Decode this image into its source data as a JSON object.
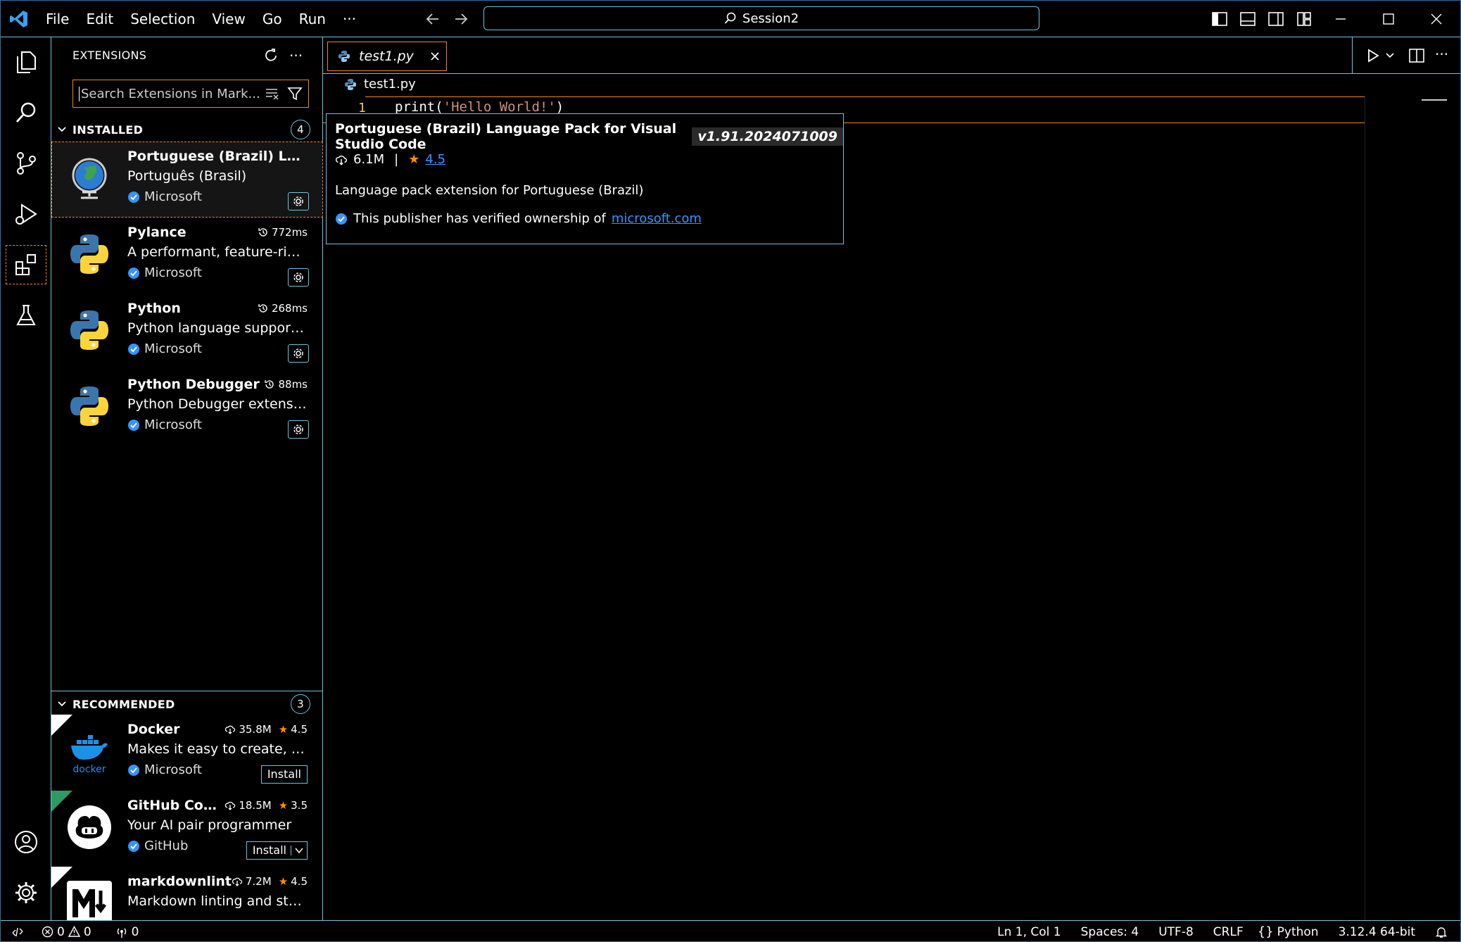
{
  "titlebar": {
    "menu": [
      "File",
      "Edit",
      "Selection",
      "View",
      "Go",
      "Run",
      "···"
    ],
    "command_center": "Session2"
  },
  "sidebar": {
    "title": "EXTENSIONS",
    "search_placeholder": "Search Extensions in Mark...",
    "installed": {
      "label": "INSTALLED",
      "count": "4",
      "items": [
        {
          "name": "Portuguese (Brazil) Langu...",
          "desc": "Português (Brasil)",
          "publisher": "Microsoft",
          "time": ""
        },
        {
          "name": "Pylance",
          "desc": "A performant, feature-rich la...",
          "publisher": "Microsoft",
          "time": "772ms"
        },
        {
          "name": "Python",
          "desc": "Python language support wi...",
          "publisher": "Microsoft",
          "time": "268ms"
        },
        {
          "name": "Python Debugger",
          "desc": "Python Debugger extension...",
          "publisher": "Microsoft",
          "time": "88ms"
        }
      ]
    },
    "recommended": {
      "label": "RECOMMENDED",
      "count": "3",
      "items": [
        {
          "name": "Docker",
          "desc": "Makes it easy to create, man...",
          "publisher": "Microsoft",
          "downloads": "35.8M",
          "rating": "4.5",
          "button": "Install",
          "icon_text": "docker"
        },
        {
          "name": "GitHub Copi...",
          "desc": "Your AI pair programmer",
          "publisher": "GitHub",
          "downloads": "18.5M",
          "rating": "3.5",
          "button": "Install"
        },
        {
          "name": "markdownlint",
          "desc": "Markdown linting and style ...",
          "publisher": "",
          "downloads": "7.2M",
          "rating": "4.5",
          "button": ""
        }
      ]
    }
  },
  "editor": {
    "tab": "test1.py",
    "breadcrumb": "test1.py",
    "line_number": "1",
    "code_fn": "print(",
    "code_str": "'Hello World!'",
    "code_end": ")"
  },
  "hover": {
    "title": "Portuguese (Brazil) Language Pack for Visual Studio Code",
    "version": "v1.91.2024071009",
    "downloads": "6.1M",
    "separator": "|",
    "rating": "4.5",
    "description": "Language pack extension for Portuguese (Brazil)",
    "verified_text": "This publisher has verified ownership of",
    "domain": "microsoft.com"
  },
  "status": {
    "errors": "0",
    "warnings": "0",
    "ports": "0",
    "position": "Ln 1, Col 1",
    "spaces": "Spaces: 4",
    "encoding": "UTF-8",
    "eol": "CRLF",
    "language": "Python",
    "interpreter": "3.12.4 64-bit"
  },
  "colors": {
    "accent": "#6fc3df",
    "focus": "#f38518",
    "link": "#3794ff",
    "star": "#ff8e00"
  }
}
